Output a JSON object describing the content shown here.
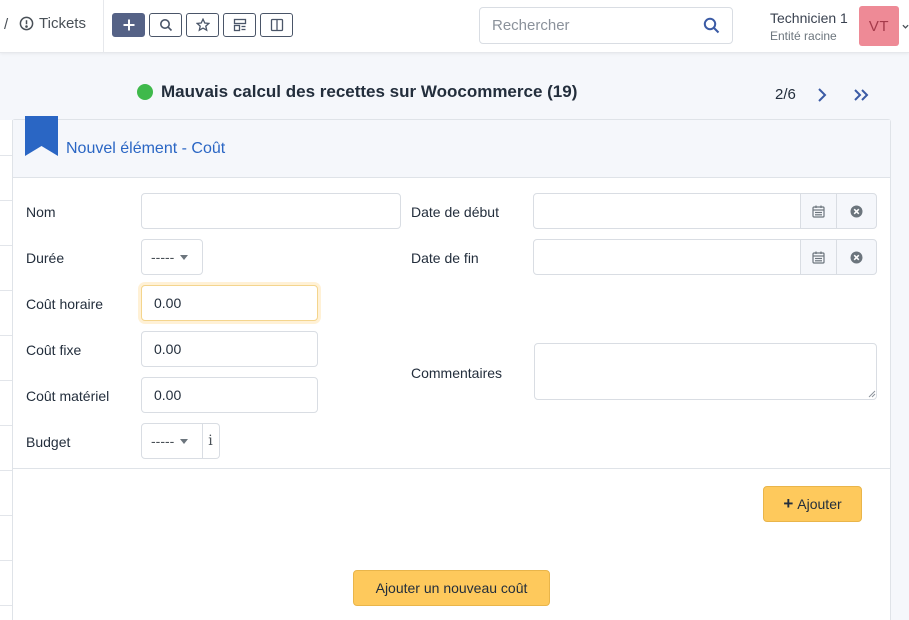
{
  "topbar": {
    "breadcrumb_separator": "/",
    "breadcrumb_label": "Tickets",
    "search_placeholder": "Rechercher",
    "user_name": "Technicien 1",
    "user_entity": "Entité racine",
    "avatar_initials": "VT"
  },
  "ticket": {
    "title": "Mauvais calcul des recettes sur Woocommerce (19)",
    "status_color": "#3fb94b",
    "pager_text": "2/6"
  },
  "form": {
    "title": "Nouvel élément - Coût",
    "labels": {
      "nom": "Nom",
      "duree": "Durée",
      "cout_horaire": "Coût horaire",
      "cout_fixe": "Coût fixe",
      "cout_materiel": "Coût matériel",
      "budget": "Budget",
      "date_debut": "Date de début",
      "date_fin": "Date de fin",
      "commentaires": "Commentaires"
    },
    "values": {
      "nom": "",
      "duree": "-----",
      "cout_horaire": "0.00",
      "cout_fixe": "0.00",
      "cout_materiel": "0.00",
      "budget": "-----",
      "date_debut": "",
      "date_fin": "",
      "commentaires": ""
    },
    "budget_info_glyph": "i",
    "add_button": "Ajouter",
    "new_cost_button": "Ajouter un nouveau coût"
  },
  "colors": {
    "accent_blue": "#2a66c4",
    "button_yellow": "#fec95c",
    "avatar_bg": "#ee8a96"
  }
}
